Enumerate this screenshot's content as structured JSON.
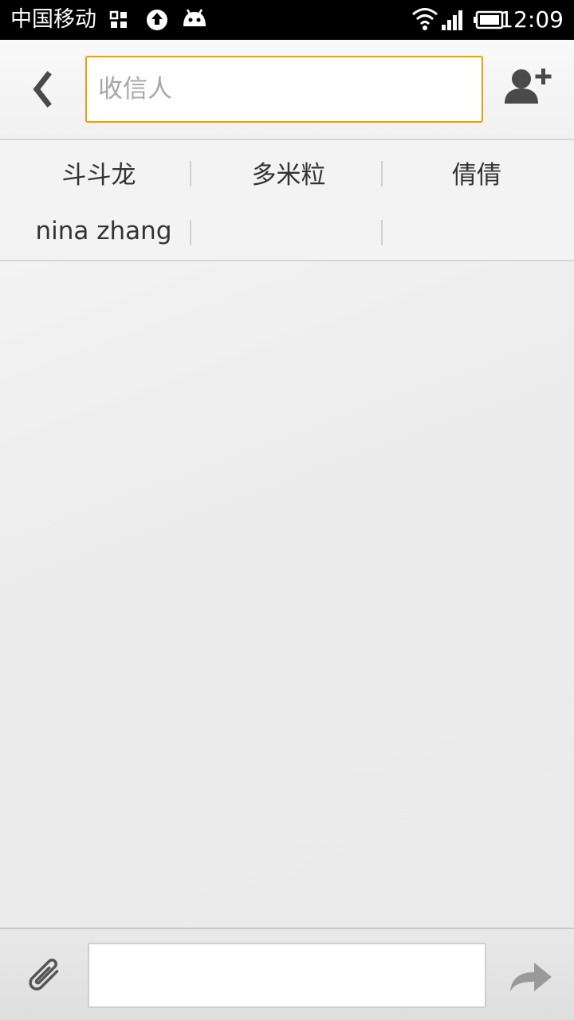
{
  "status_bar": {
    "carrier": "中国移动",
    "time": "12:09",
    "icons": [
      "apps-icon",
      "upload-icon",
      "android-icon",
      "wifi-icon",
      "signal-icon",
      "battery-icon"
    ]
  },
  "header": {
    "recipient_placeholder": "收信人",
    "recipient_value": "",
    "back_icon": "chevron-left-icon",
    "add_contact_icon": "add-contact-icon"
  },
  "suggestions": [
    [
      "斗斗龙",
      "多米粒",
      "倩倩"
    ],
    [
      "nina zhang",
      "",
      ""
    ]
  ],
  "compose": {
    "message_value": "",
    "attach_icon": "paperclip-icon",
    "send_icon": "send-arrow-icon"
  },
  "colors": {
    "accent": "#f0a000",
    "background": "#ececec",
    "text": "#333333",
    "placeholder": "#a6a6a6"
  }
}
